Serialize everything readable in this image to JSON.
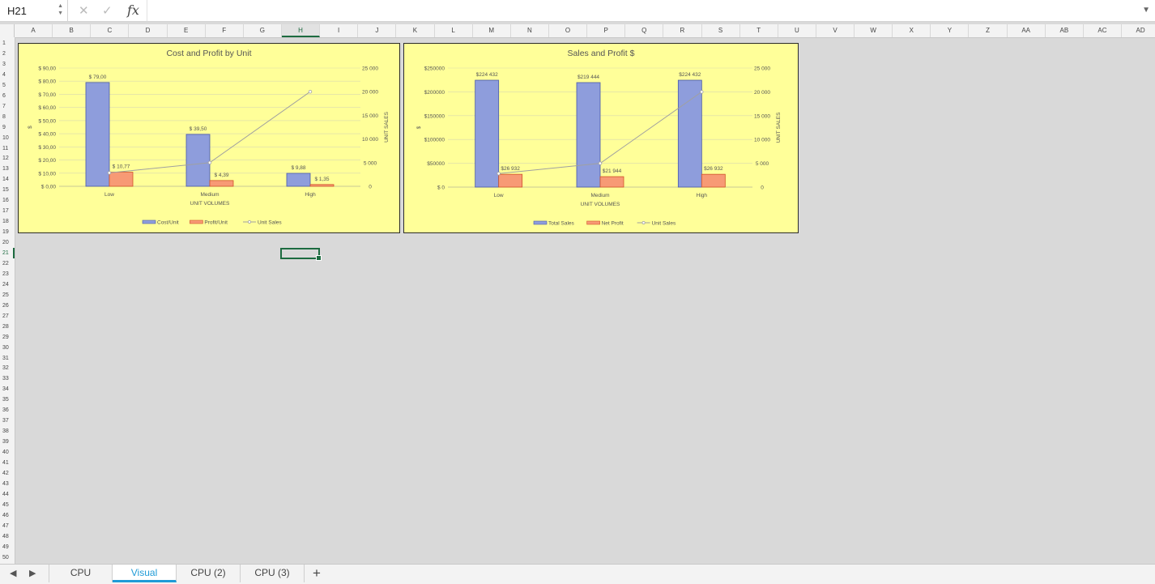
{
  "formula_bar": {
    "cell_ref": "H21",
    "fx_label": "fx",
    "cancel_icon": "✕",
    "confirm_icon": "✓",
    "formula": ""
  },
  "columns": [
    "A",
    "B",
    "C",
    "D",
    "E",
    "F",
    "G",
    "H",
    "I",
    "J",
    "K",
    "L",
    "M",
    "N",
    "O",
    "P",
    "Q",
    "R",
    "S",
    "T",
    "U",
    "V",
    "W",
    "X",
    "Y",
    "Z",
    "AA",
    "AB",
    "AC",
    "AD"
  ],
  "selected_column": "H",
  "rows": [
    "1",
    "2",
    "3",
    "4",
    "5",
    "6",
    "7",
    "8",
    "9",
    "10",
    "11",
    "12",
    "13",
    "14",
    "15",
    "16",
    "17",
    "18",
    "19",
    "20",
    "21",
    "22",
    "23",
    "24",
    "25",
    "26",
    "27",
    "28",
    "29",
    "30",
    "31",
    "32",
    "33",
    "34",
    "35",
    "36",
    "37",
    "38",
    "39",
    "40",
    "41",
    "42",
    "43",
    "44",
    "45",
    "46",
    "47",
    "48",
    "49",
    "50"
  ],
  "selected_row": "21",
  "chart_data": [
    {
      "type": "bar",
      "title": "Cost and Profit by Unit",
      "categories": [
        "Low",
        "Medium",
        "High"
      ],
      "xlabel": "UNIT VOLUMES",
      "ylabel": "$",
      "y2label": "UNIT SALES",
      "ylim": [
        0,
        90
      ],
      "y_ticks": [
        "$ 0,00",
        "$ 10,00",
        "$ 20,00",
        "$ 30,00",
        "$ 40,00",
        "$ 50,00",
        "$ 60,00",
        "$ 70,00",
        "$ 80,00",
        "$ 90,00"
      ],
      "y2lim": [
        0,
        25000
      ],
      "y2_ticks": [
        "0",
        "5 000",
        "10 000",
        "15 000",
        "20 000",
        "25 000"
      ],
      "series": [
        {
          "name": "Cost/Unit",
          "values": [
            79.0,
            39.5,
            9.88
          ],
          "labels": [
            "$ 79,00",
            "$ 39,50",
            "$ 9,88"
          ],
          "color": "#8e9ddc"
        },
        {
          "name": "Profit/Unit",
          "values": [
            10.77,
            4.39,
            1.35
          ],
          "labels": [
            "$ 10,77",
            "$ 4,39",
            "$ 1,35"
          ],
          "color": "#f79a75"
        },
        {
          "name": "Unit Sales",
          "type": "line",
          "axis": "secondary",
          "values": [
            2842,
            5000,
            20000
          ],
          "color": "#a0a0a0"
        }
      ],
      "legend_position": "bottom"
    },
    {
      "type": "bar",
      "title": "Sales and Profit $",
      "categories": [
        "Low",
        "Medium",
        "High"
      ],
      "xlabel": "UNIT VOLUMES",
      "ylabel": "$",
      "y2label": "UNIT SALES",
      "ylim": [
        0,
        250000
      ],
      "y_ticks": [
        "$ 0",
        "$50000",
        "$100000",
        "$150000",
        "$200000",
        "$250000"
      ],
      "y2lim": [
        0,
        25000
      ],
      "y2_ticks": [
        "0",
        "5 000",
        "10 000",
        "15 000",
        "20 000",
        "25 000"
      ],
      "series": [
        {
          "name": "Total Sales",
          "values": [
            224432,
            219444,
            224432
          ],
          "labels": [
            "$224 432",
            "$219 444",
            "$224 432"
          ],
          "color": "#8e9ddc"
        },
        {
          "name": "Net Profit",
          "values": [
            26932,
            21944,
            26932
          ],
          "labels": [
            "$26 932",
            "$21 944",
            "$26 932"
          ],
          "color": "#f79a75"
        },
        {
          "name": "Unit Sales",
          "type": "line",
          "axis": "secondary",
          "values": [
            2842,
            5000,
            20000
          ],
          "color": "#a0a0a0"
        }
      ],
      "legend_position": "bottom"
    }
  ],
  "sheet_tabs": [
    {
      "label": "CPU",
      "active": false
    },
    {
      "label": "Visual",
      "active": true
    },
    {
      "label": "CPU (2)",
      "active": false
    },
    {
      "label": "CPU (3)",
      "active": false
    }
  ],
  "add_sheet_label": "+",
  "nav": {
    "prev": "◀",
    "next": "▶"
  }
}
